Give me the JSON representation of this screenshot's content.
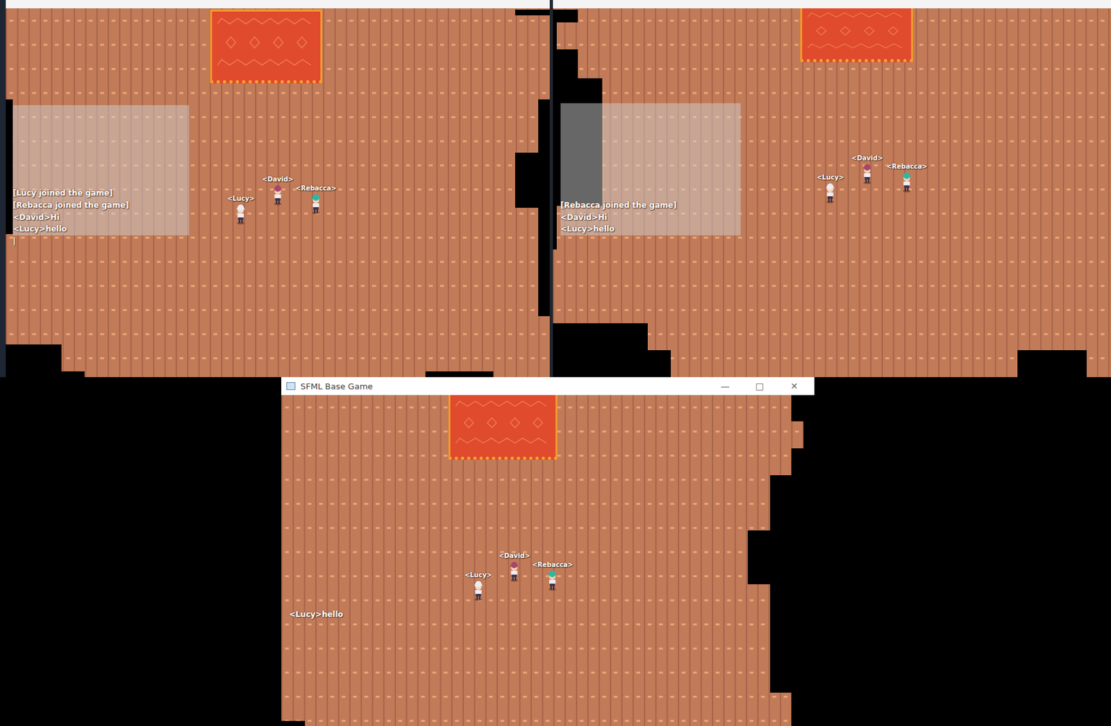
{
  "windows": [
    {
      "title_bar": null,
      "chat": {
        "open": true,
        "typing": true,
        "caret": "|",
        "lines": [
          "[Lucy joined the game]",
          "[Rebacca joined the game]",
          "<David>Hi",
          "<Lucy>hello"
        ]
      },
      "players": [
        {
          "name": "<Lucy>",
          "color": "#ecebf2"
        },
        {
          "name": "<David>",
          "color": "#a8466a"
        },
        {
          "name": "<Rebacca>",
          "color": "#2bb7a6"
        }
      ]
    },
    {
      "title_bar": null,
      "chat": {
        "open": true,
        "typing": false,
        "caret": "",
        "lines": [
          "[Rebacca joined the game]",
          "<David>Hi",
          "<Lucy>hello"
        ]
      },
      "players": [
        {
          "name": "<Lucy>",
          "color": "#ecebf2"
        },
        {
          "name": "<David>",
          "color": "#a8466a"
        },
        {
          "name": "<Rebacca>",
          "color": "#2bb7a6"
        }
      ]
    },
    {
      "title_bar": {
        "title": "SFML Base Game",
        "controls": [
          "—",
          "□",
          "✕"
        ]
      },
      "chat": {
        "open": false,
        "typing": false,
        "caret": "",
        "lines": [
          "<Lucy>hello"
        ]
      },
      "players": [
        {
          "name": "<Lucy>",
          "color": "#ecebf2"
        },
        {
          "name": "<David>",
          "color": "#a8466a"
        },
        {
          "name": "<Rebacca>",
          "color": "#2bb7a6"
        }
      ]
    }
  ]
}
